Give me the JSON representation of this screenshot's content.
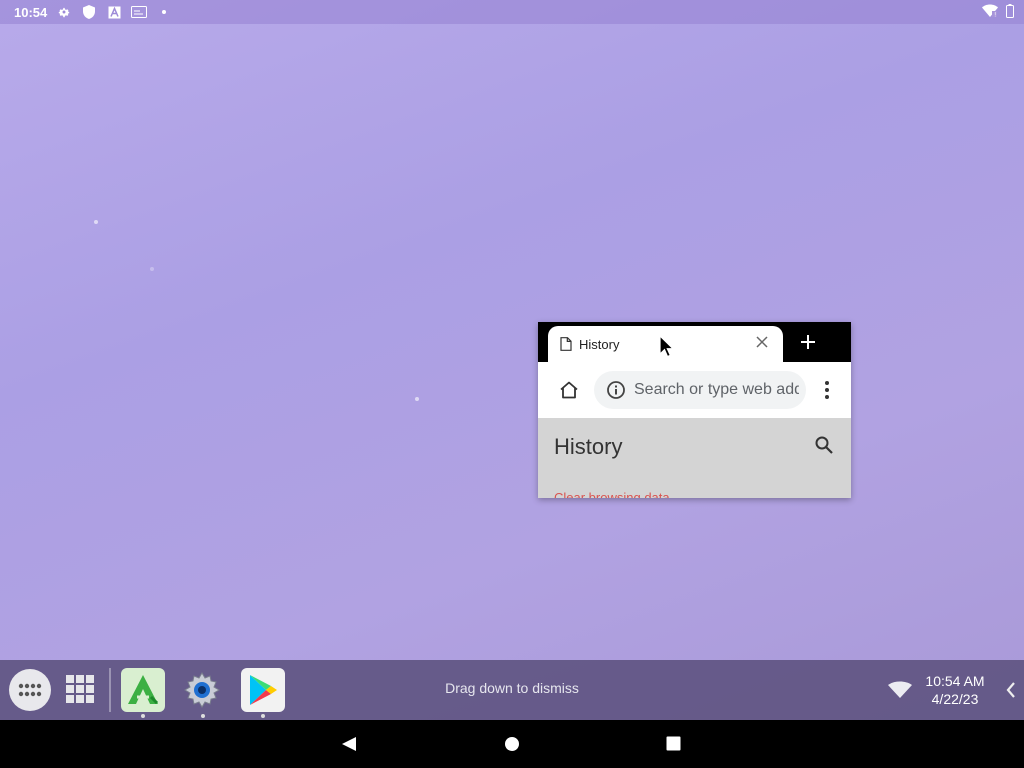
{
  "status_bar": {
    "time": "10:54",
    "icons": [
      "gear-icon",
      "shield-icon",
      "font-a-icon",
      "screen-icon",
      "dot-icon"
    ],
    "right_icons": [
      "wifi-signal-icon",
      "battery-icon"
    ]
  },
  "browser": {
    "tab_title": "History",
    "address_placeholder": "Search or type web address",
    "page_heading": "History",
    "clear_link": "Clear browsing data..."
  },
  "taskbar": {
    "hint": "Drag down to dismiss",
    "clock_time": "10:54 AM",
    "clock_date": "4/22/23",
    "apps": [
      "APKPure",
      "Settings",
      "Google Play Store"
    ]
  },
  "colors": {
    "wallpaper": "#ab9fe4",
    "taskbar": "#5f5582",
    "tab_strip": "#000000",
    "clear_link": "#d9534f"
  }
}
